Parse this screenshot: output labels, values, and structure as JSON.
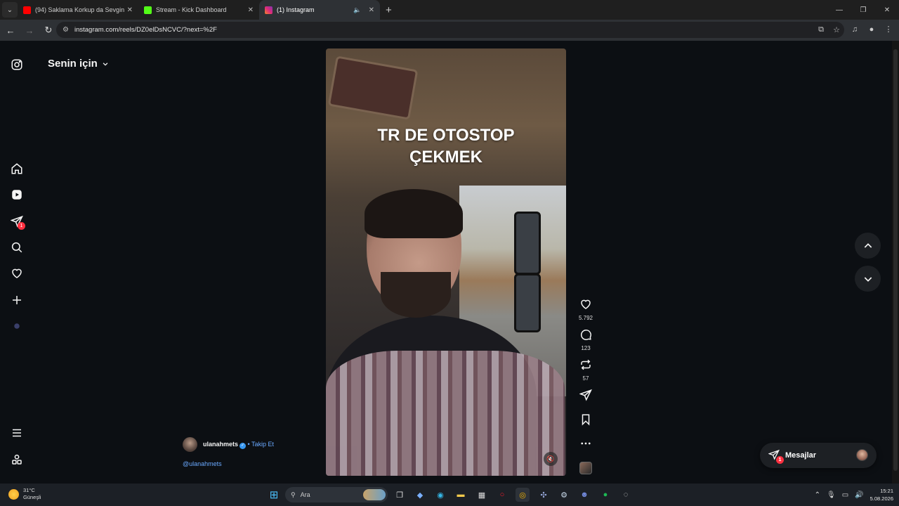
{
  "browser": {
    "tabs": [
      {
        "title": "(94) Saklama Korkup da Sevgin",
        "favicon_color": "#ff0000",
        "active": false
      },
      {
        "title": "Stream - Kick Dashboard",
        "favicon_color": "#53fc18",
        "active": false
      },
      {
        "title": "(1) Instagram",
        "favicon_color": "#e1306c",
        "active": true
      }
    ],
    "url": "instagram.com/reels/DZ0elDsNCVC/?next=%2F"
  },
  "instagram": {
    "feed_heading": "Senin için",
    "notifications_badge": "1",
    "reel": {
      "caption": "TR DE OTOSTOP\nÇEKMEK",
      "likes": "5.792",
      "comments": "123",
      "reposts": "57"
    },
    "author": {
      "username": "ulanahmets",
      "separator": "•",
      "follow_label": "Takip Et",
      "mention": "@ulanahmets"
    },
    "messages": {
      "label": "Mesajlar",
      "badge": "1"
    }
  },
  "taskbar": {
    "weather_temp": "31°C",
    "weather_desc": "Güneşli",
    "search_placeholder": "Ara",
    "time": "15:21",
    "date": "5.08.2026"
  },
  "colors": {
    "accent_link": "#6aa9ff",
    "badge_red": "#ff3040",
    "page_bg": "#0c0f13"
  }
}
